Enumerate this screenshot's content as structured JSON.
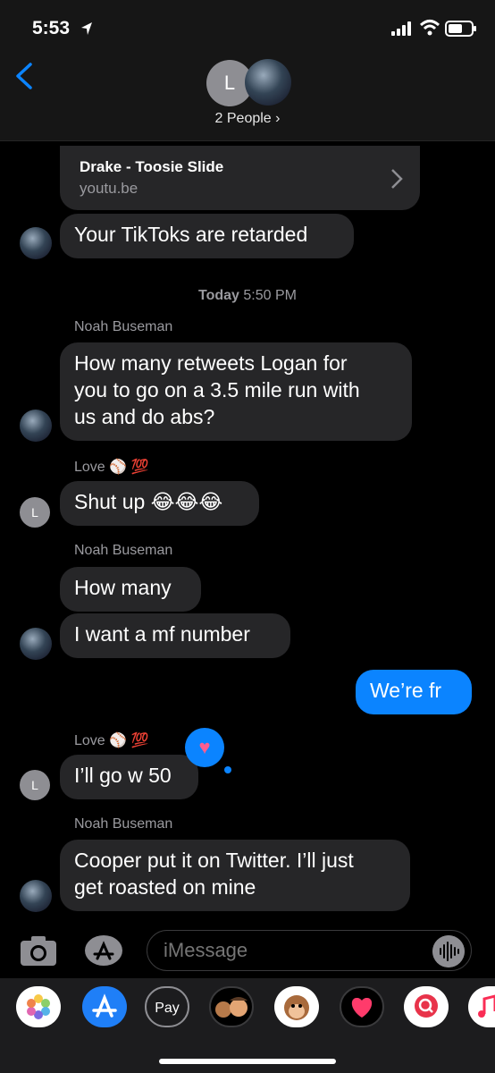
{
  "status_bar": {
    "time": "5:53"
  },
  "header": {
    "avatar_initial": "L",
    "people_label": "2 People ›"
  },
  "link_preview": {
    "title": "Drake - Toosie Slide",
    "domain": "youtu.be"
  },
  "messages": [
    {
      "text": "Your TikToks are retarded"
    },
    {
      "text": "How many retweets Logan for you to go on a 3.5 mile run with us and do abs?",
      "line1": "How many retweets Logan for",
      "line2": "you to go on a 3.5 mile run with",
      "line3": "us and do abs?"
    },
    {
      "text": "Shut up 😂😂😂"
    },
    {
      "text": "How many"
    },
    {
      "text": "I want a mf number"
    },
    {
      "text": "We’re fr"
    },
    {
      "text": "I’ll go w 50"
    },
    {
      "text": "Cooper put it on Twitter. I’ll just get roasted on mine",
      "line1": "Cooper put it on Twitter. I’ll just",
      "line2": "get roasted on mine"
    }
  ],
  "timestamp": {
    "day": "Today",
    "time": "5:50 PM"
  },
  "senders": {
    "noah": "Noah Buseman",
    "love": "Love ⚾ 💯"
  },
  "avatar_l": "L",
  "input": {
    "placeholder": "iMessage"
  },
  "drawer": {
    "apps": [
      "photos-icon",
      "app-store-icon",
      "apple-pay-icon",
      "memoji-icon",
      "animoji-icon",
      "digital-touch-icon",
      "search-web-icon",
      "music-icon"
    ],
    "apple_pay_label": "Pay"
  },
  "colors": {
    "bubble_incoming": "#262628",
    "bubble_outgoing": "#0b84ff",
    "accent": "#0b84ff"
  }
}
